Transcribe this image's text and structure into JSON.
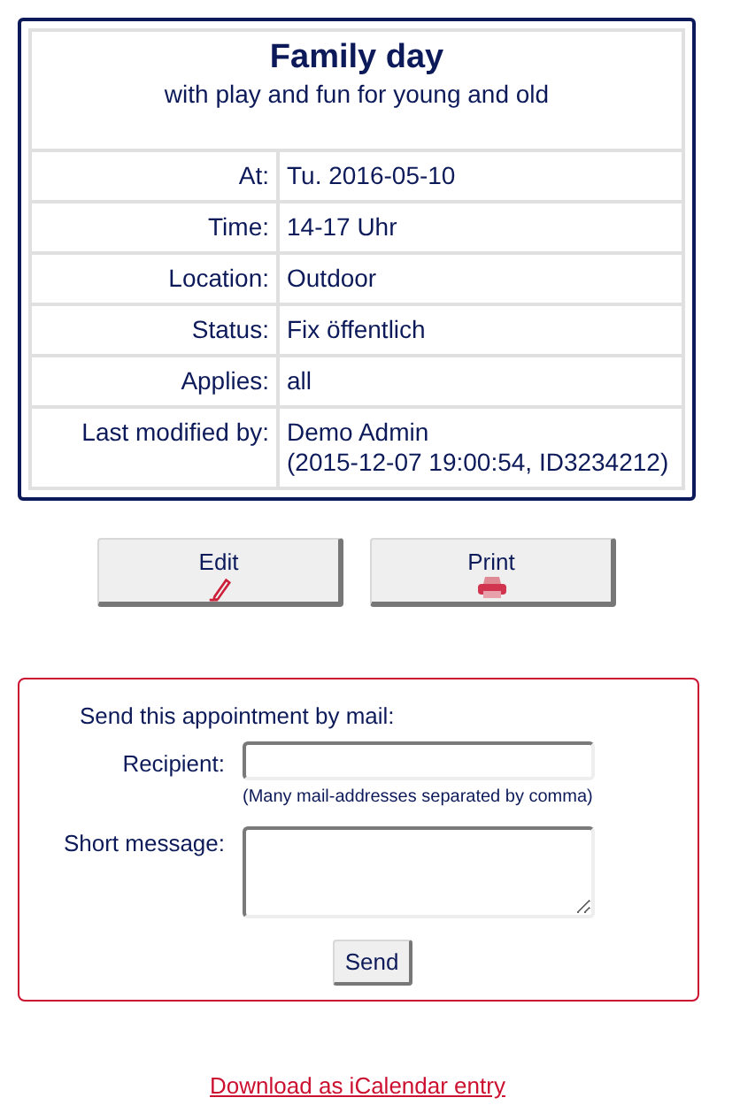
{
  "event": {
    "title": "Family day",
    "subtitle": "with play and fun for young and old"
  },
  "details": [
    {
      "label": "At:",
      "value": "Tu. 2016-05-10"
    },
    {
      "label": "Time:",
      "value": "14-17 Uhr"
    },
    {
      "label": "Location:",
      "value": "Outdoor"
    },
    {
      "label": "Status:",
      "value": "Fix öffentlich"
    },
    {
      "label": "Applies:",
      "value": "all"
    },
    {
      "label": "Last modified by:",
      "value": "Demo Admin",
      "note": "(2015-12-07 19:00:54, ID3234212)"
    }
  ],
  "actions": [
    {
      "label": "Edit",
      "kind": "pencil"
    },
    {
      "label": "Print",
      "kind": "printer"
    }
  ],
  "mail_form": {
    "heading": "Send this appointment by mail:",
    "recipient_label": "Recipient:",
    "recipient_hint": "(Many mail-addresses separated by comma)",
    "message_label": "Short message:",
    "send_button": "Send"
  },
  "download_link": "Download as iCalendar entry"
}
